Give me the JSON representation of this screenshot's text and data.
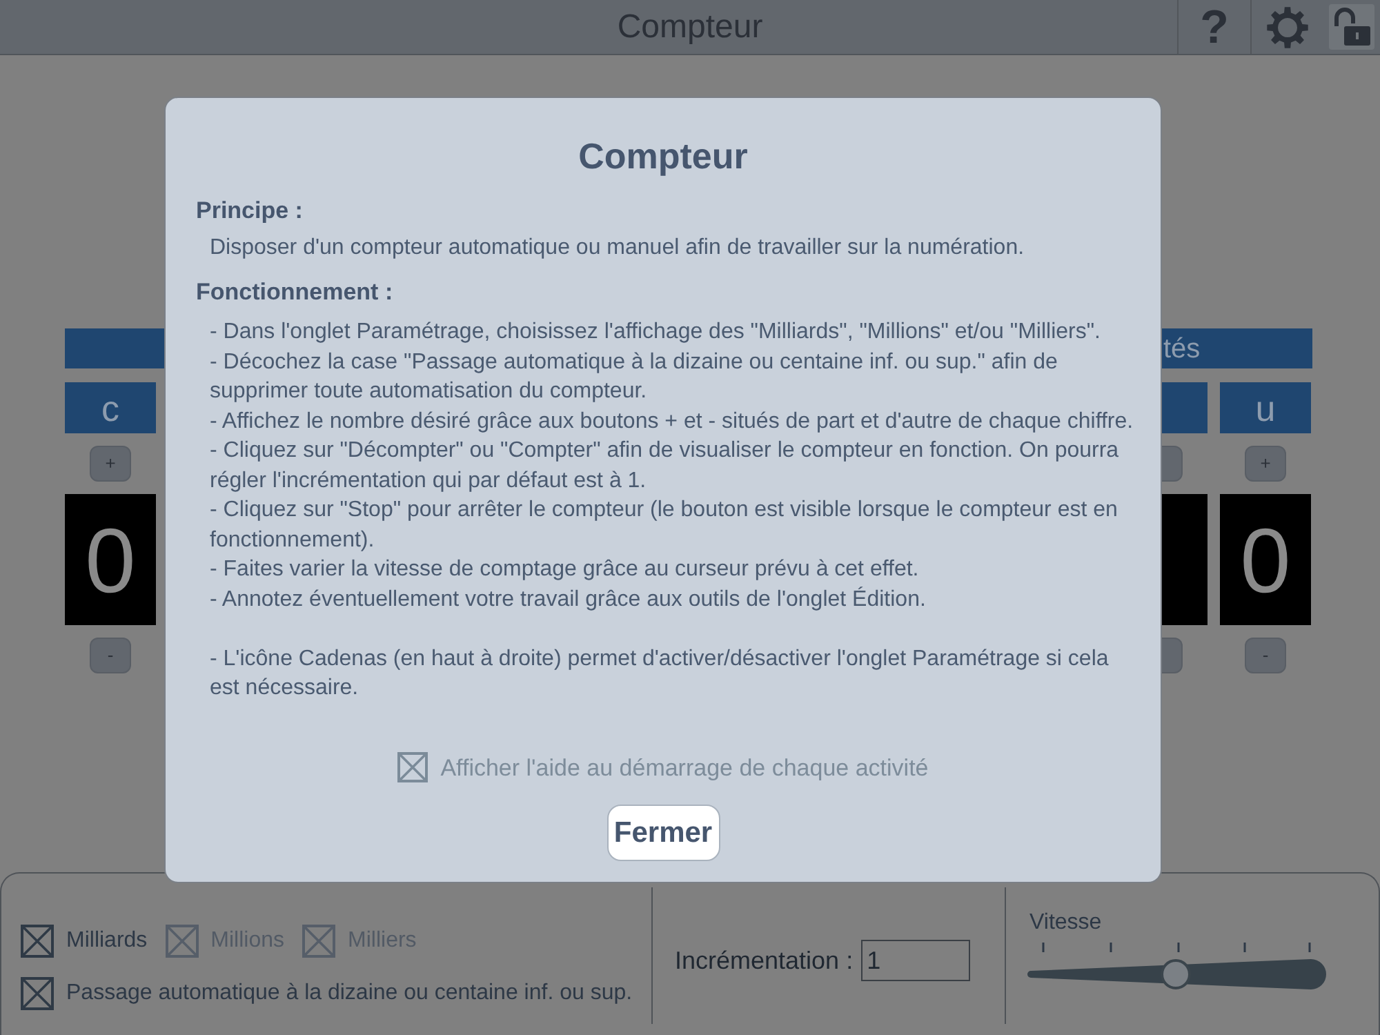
{
  "top_bar": {
    "title": "Compteur",
    "help_button": "?"
  },
  "counter": {
    "left_columns": [
      {
        "letter": "c",
        "plus": "+",
        "digit": "0",
        "minus": "-"
      }
    ],
    "right_group_label": "tés",
    "right_columns": [
      {
        "letter": "u",
        "plus": "+",
        "digit": "0",
        "minus": "-"
      }
    ]
  },
  "dialog": {
    "title": "Compteur",
    "sections": [
      {
        "heading": "Principe :",
        "paragraphs": [
          "Disposer d'un compteur automatique ou manuel afin de travailler sur la numération."
        ]
      },
      {
        "heading": "Fonctionnement :",
        "paragraphs": [
          "- Dans l'onglet Paramétrage, choisissez l'affichage des \"Milliards\", \"Millions\" et/ou \"Milliers\".",
          "- Décochez la case \"Passage automatique à la dizaine ou centaine inf. ou sup.\" afin de supprimer toute automatisation du compteur.",
          "- Affichez le nombre désiré grâce aux boutons + et - situés de part et d'autre de chaque chiffre.",
          "- Cliquez sur \"Décompter\" ou \"Compter\" afin de visualiser le compteur en fonction. On pourra régler l'incrémentation qui par défaut est à 1.",
          "- Cliquez sur \"Stop\" pour arrêter le compteur (le bouton est visible lorsque le compteur est en fonctionnement).",
          "- Faites varier la vitesse de comptage grâce au curseur prévu à cet effet.",
          "- Annotez éventuellement votre travail grâce aux outils de l'onglet Édition."
        ]
      }
    ],
    "note": "- L'icône Cadenas (en haut à droite) permet d'activer/désactiver l'onglet Paramétrage si cela est nécessaire.",
    "show_help": {
      "label": "Afficher l'aide au démarrage de chaque activité",
      "checked": true
    },
    "close_button": "Fermer"
  },
  "settings": {
    "display_options": [
      {
        "label": "Milliards",
        "checked": true,
        "disabled": false
      },
      {
        "label": "Millions",
        "checked": true,
        "disabled": true
      },
      {
        "label": "Milliers",
        "checked": true,
        "disabled": true
      }
    ],
    "auto_carry": {
      "label": "Passage automatique à la dizaine ou centaine inf. ou sup.",
      "checked": true
    },
    "increment": {
      "label": "Incrémentation :",
      "value": "1"
    },
    "speed": {
      "label": "Vitesse",
      "level": 0.5
    }
  }
}
